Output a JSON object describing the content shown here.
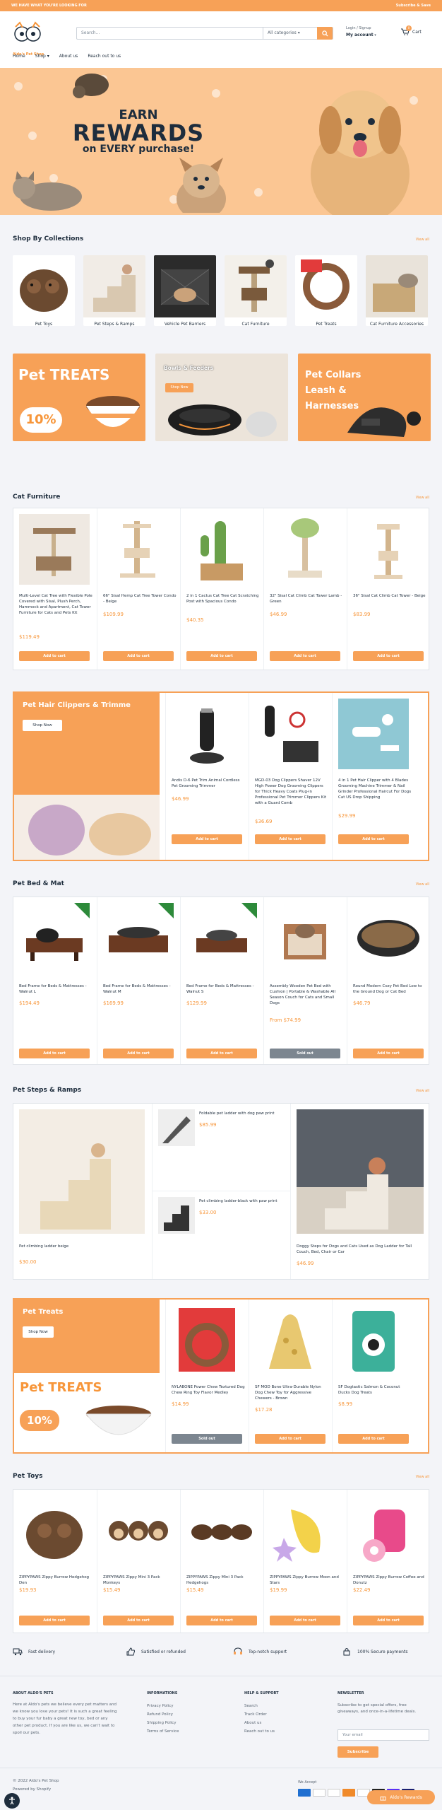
{
  "announcement": {
    "left": "WE HAVE WHAT YOU'RE LOOKING FOR",
    "right": "Subscribe & Save"
  },
  "header": {
    "logo_text": "Aldo's Pet Shop",
    "search_placeholder": "Search...",
    "category_select": "All categories",
    "login": "Login / Signup",
    "account": "My account",
    "cart_label": "Cart",
    "cart_count": "0"
  },
  "nav": [
    {
      "label": "Home"
    },
    {
      "label": "Shop"
    },
    {
      "label": "About us"
    },
    {
      "label": "Reach out to us"
    }
  ],
  "hero": {
    "line1": "EARN",
    "line2": "REWARDS",
    "line3": "on EVERY purchase!"
  },
  "collections": {
    "title": "Shop By Collections",
    "view_all": "View all",
    "items": [
      {
        "label": "Pet Toys"
      },
      {
        "label": "Pet Steps & Ramps"
      },
      {
        "label": "Vehicle Pet Barriers"
      },
      {
        "label": "Cat Furniture"
      },
      {
        "label": "Pet Treats"
      },
      {
        "label": "Cat Furniture Accessories"
      }
    ]
  },
  "promos": {
    "treats": "Pet TREATS",
    "treats_badge": "10%",
    "bowls": "Bowls & Feeders",
    "bowls_btn": "Shop Now",
    "collars": "Pet Collars Leash & Harnesses"
  },
  "cat_furniture": {
    "title": "Cat Furniture",
    "view_all": "View all",
    "products": [
      {
        "title": "Multi-Level Cat Tree with Flexible Pole Covered with Sisal, Plush Perch, Hammock and Apartment, Cat Tower Furniture for Cats and Pets Kit",
        "price": "$119.49",
        "button": "Add to cart"
      },
      {
        "title": "66\" Sisal Hemp Cat Tree Tower Condo - Beige",
        "price": "$109.99",
        "button": "Add to cart"
      },
      {
        "title": "2 in 1 Cactus Cat Tree Cat Scratching Post with Spacious Condo",
        "price": "$40.35",
        "button": "Add to cart"
      },
      {
        "title": "32\" Sisal Cat Climb Cat Tower Lamb - Green",
        "price": "$46.99",
        "button": "Add to cart"
      },
      {
        "title": "36\" Sisal Cat Climb Cat Tower - Beige",
        "price": "$83.99",
        "button": "Add to cart"
      }
    ]
  },
  "clippers": {
    "banner_title": "Pet Hair Clippers & Trimme",
    "banner_btn": "Shop Now",
    "products": [
      {
        "title": "Andis D-6 Pet Trim Animal Cordless Pet Grooming Trimmer",
        "price": "$46.99",
        "button": "Add to cart"
      },
      {
        "title": "MGD-03 Dog Clippers Shaver 12V High Power Dog Grooming Clippers for Thick Heavy Coats Plug-in Professional Pet Trimmer Clippers Kit with a Guard Comb",
        "price": "$36.69",
        "button": "Add to cart"
      },
      {
        "title": "4 in 1 Pet Hair Clipper with 4 Blades Grooming Machine Trimmer & Nail Grinder Professional Haircut For Dogs Cat US Drop Shipping",
        "price": "$29.99",
        "button": "Add to cart"
      }
    ]
  },
  "bed_mat": {
    "title": "Pet Bed & Mat",
    "view_all": "View all",
    "products": [
      {
        "title": "Bed Frame for Beds & Mattresses - Walnut L",
        "price": "$194.49",
        "button": "Add to cart"
      },
      {
        "title": "Bed Frame for Beds & Mattresses - Walnut M",
        "price": "$169.99",
        "button": "Add to cart"
      },
      {
        "title": "Bed Frame for Beds & Mattresses - Walnut S",
        "price": "$129.99",
        "button": "Add to cart"
      },
      {
        "title": "Assembly Wooden Pet Bed with Cushion | Portable & Washable All Season Couch for Cats and Small Dogs",
        "price": "From $74.99",
        "button": "Sold out"
      },
      {
        "title": "Round Modern Cozy Pet Bed Low to the Ground Dog or Cat Bed",
        "price": "$46.79",
        "button": "Add to cart"
      }
    ]
  },
  "steps": {
    "title": "Pet Steps & Ramps",
    "view_all": "View all",
    "big1": {
      "title": "Pet climbing ladder beige",
      "price": "$30.00"
    },
    "small1": {
      "title": "Foldable pet ladder with dog paw print",
      "price": "$85.99"
    },
    "small2": {
      "title": "Pet climbing ladder-black with paw print",
      "price": "$33.00"
    },
    "big2": {
      "title": "Doggy Steps for Dogs and Cats Used as Dog Ladder for Tall Couch, Bed, Chair or Car",
      "price": "$46.99"
    }
  },
  "treats": {
    "banner_title": "Pet Treats",
    "banner_btn": "Shop Now",
    "banner_big": "Pet TREATS",
    "banner_badge": "10%",
    "products": [
      {
        "title": "NYLABONE Power Chew Textured Dog Chew Ring Toy Flavor Medley",
        "price": "$14.99",
        "button": "Sold out"
      },
      {
        "title": "SF MOD Bone Ultra-Durable Nylon Dog Chew Toy for Aggressive Chewers - Brown",
        "price": "$17.28",
        "button": "Add to cart"
      },
      {
        "title": "SF Dogtastic Salmon & Coconut Ducks Dog Treats",
        "price": "$8.99",
        "button": "Add to cart"
      }
    ]
  },
  "toys": {
    "title": "Pet Toys",
    "view_all": "View all",
    "products": [
      {
        "title": "ZIPPYPAWS Zippy Burrow Hedgehog Den",
        "price": "$19.93",
        "button": "Add to cart"
      },
      {
        "title": "ZIPPYPAWS Zippy Mini 3 Pack Monkeys",
        "price": "$15.49",
        "button": "Add to cart"
      },
      {
        "title": "ZIPPYPAWS Zippy Mini 3 Pack Hedgehogs",
        "price": "$15.49",
        "button": "Add to cart"
      },
      {
        "title": "ZIPPYPAWS Zippy Burrow Moon and Stars",
        "price": "$19.99",
        "button": "Add to cart"
      },
      {
        "title": "ZIPPYPAWS Zippy Burrow Coffee and Donutz",
        "price": "$22.49",
        "button": "Add to cart"
      }
    ]
  },
  "features": [
    {
      "label": "Fast delivery"
    },
    {
      "label": "Satisfied or refunded"
    },
    {
      "label": "Top-notch support"
    },
    {
      "label": "100% Secure payments"
    }
  ],
  "footer": {
    "about_title": "ABOUT ALDO'S PETS",
    "about_text": "Here at Aldo's pets we believe every pet matters and we know you love your pets! It is such a great feeling to buy your fur baby a great new toy, bed or any other pet product. If you are like us, we can't wait to spoil our pets.",
    "info_title": "INFORMATIONS",
    "info_links": [
      {
        "label": "Privacy Policy"
      },
      {
        "label": "Refund Policy"
      },
      {
        "label": "Shipping Policy"
      },
      {
        "label": "Terms of Service"
      }
    ],
    "help_title": "HELP & SUPPORT",
    "help_links": [
      {
        "label": "Search"
      },
      {
        "label": "Track Order"
      },
      {
        "label": "About us"
      },
      {
        "label": "Reach out to us"
      }
    ],
    "news_title": "NEWSLETTER",
    "news_text": "Subscribe to get special offers, free giveaways, and once-in-a-lifetime deals.",
    "email_placeholder": "Your email",
    "subscribe": "Subscribe",
    "copyright": "© 2022 Aldo's Pet Shop",
    "powered": "Powered by Shopify",
    "we_accept": "We Accept",
    "rewards": "Aldo's Rewards"
  },
  "colors": {
    "accent": "#f7a157",
    "text": "#1e2d3d",
    "price": "#f7963a"
  }
}
